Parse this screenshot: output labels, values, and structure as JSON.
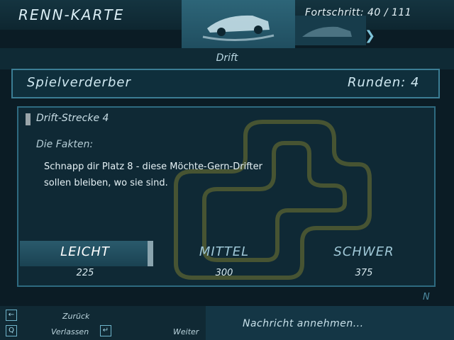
{
  "header": {
    "title": "RENN-KARTE",
    "progress": "Fortschritt: 40 / 111"
  },
  "mode": {
    "label": "Drift",
    "tabs": [
      "car-drift-icon",
      "car-secondary-icon"
    ],
    "next_icon": "double-chevron-right-icon"
  },
  "event": {
    "name": "Spielverderber",
    "laps": "Runden: 4",
    "track": "Drift-Strecke 4",
    "facts_label": "Die Fakten:",
    "facts_line1": "Schnapp dir Platz 8 - diese Möchte-Gern-Drifter",
    "facts_line2": "sollen bleiben, wo sie sind."
  },
  "difficulty": {
    "selected": "LEICHT",
    "options": [
      {
        "label": "LEICHT",
        "value": "225"
      },
      {
        "label": "MITTEL",
        "value": "300"
      },
      {
        "label": "SCHWER",
        "value": "375"
      }
    ]
  },
  "corner_label": "N",
  "footer": {
    "back": "Zurück",
    "quit": "Verlassen",
    "next": "Weiter",
    "key_back": "←",
    "key_quit": "Q",
    "key_next": "↵",
    "accept": "Nachricht annehmen..."
  },
  "colors": {
    "background": "#0b1c25",
    "accent": "#3b7d94",
    "track_outline": "#9b9a3a"
  }
}
